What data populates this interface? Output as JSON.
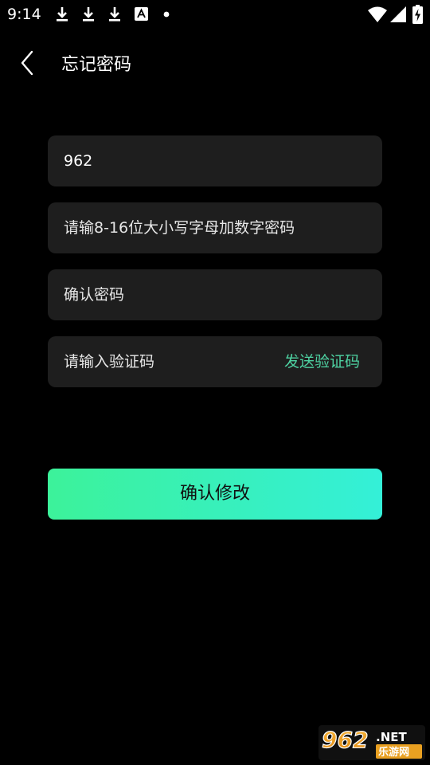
{
  "status_bar": {
    "time": "9:14",
    "notification_icons": [
      "download-icon",
      "download-icon",
      "download-icon",
      "font-app-icon",
      "dot-icon"
    ],
    "system_icons": [
      "wifi-icon",
      "signal-icon",
      "battery-charging-icon"
    ]
  },
  "header": {
    "back_icon": "chevron-left-icon",
    "title": "忘记密码"
  },
  "form": {
    "phone": {
      "value": "962",
      "placeholder": ""
    },
    "password": {
      "value": "",
      "placeholder": "请输8-16位大小写字母加数字密码"
    },
    "confirm_password": {
      "value": "",
      "placeholder": "确认密码"
    },
    "verification_code": {
      "value": "",
      "placeholder": "请输入验证码",
      "send_label": "发送验证码"
    },
    "submit_label": "确认修改"
  },
  "watermark": {
    "text": "962.NET 乐游网"
  },
  "colors": {
    "background": "#000000",
    "field_background": "#1e1e1e",
    "accent_text": "#4ed2a2",
    "button_gradient_start": "#3cf29a",
    "button_gradient_end": "#34f0d8"
  }
}
